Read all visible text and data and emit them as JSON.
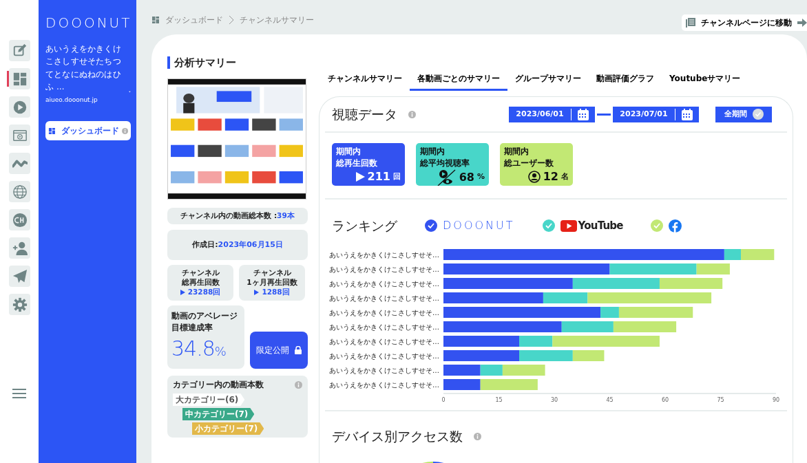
{
  "rail": {
    "items": [
      {
        "kind": "edit",
        "selected": false
      },
      {
        "kind": "dashboard",
        "selected": true
      },
      {
        "kind": "play",
        "selected": false
      },
      {
        "kind": "video",
        "selected": false
      },
      {
        "kind": "wave",
        "selected": false
      },
      {
        "kind": "globe",
        "selected": false
      },
      {
        "kind": "ch",
        "selected": false
      },
      {
        "kind": "add-user",
        "selected": false
      },
      {
        "kind": "send",
        "selected": false
      },
      {
        "kind": "gear",
        "selected": false
      }
    ]
  },
  "brand": {
    "logo": "DOOONUT",
    "channel_name": "あいうえをかきくけこさしすせそたちつてとなにぬねのはひふ …",
    "domain": "aiueo.dooonut.jp",
    "nav_button": "ダッシュボード"
  },
  "breadcrumb": [
    "ダッシュボード",
    "チャンネルサマリー"
  ],
  "channel_page_button": "チャンネルページに移動",
  "summary": {
    "title": "分析サマリー",
    "video_count": {
      "label": "チャンネル内の動画総本数 : ",
      "value": "39本"
    },
    "created": {
      "label": "作成日: ",
      "value": "2023年06月15日"
    },
    "plays": [
      {
        "label": [
          "チャンネル",
          "総再生回数"
        ],
        "value": "23288回"
      },
      {
        "label": [
          "チャンネル",
          "1ヶ月再生回数"
        ],
        "value": "1288回"
      }
    ],
    "achievement": {
      "label": [
        "動画のアベレージ",
        "目標達成率"
      ],
      "value": "34.8",
      "unit": "%"
    },
    "visibility_button": "限定公開",
    "categories": {
      "title": "カテゴリー内の動画本数",
      "steps": [
        {
          "label": "大カテゴリー(6)",
          "color": "#ffffff"
        },
        {
          "label": "中カテゴリー(7)",
          "color": "#3aa98a"
        },
        {
          "label": "小カテゴリー(7)",
          "color": "#e2b84a"
        }
      ]
    }
  },
  "tabs": [
    {
      "label": "チャンネルサマリー",
      "selected": false
    },
    {
      "label": "各動画ごとのサマリー",
      "selected": true
    },
    {
      "label": "グループサマリー",
      "selected": false
    },
    {
      "label": "動画評価グラフ",
      "selected": false
    },
    {
      "label": "Youtubeサマリー",
      "selected": false
    }
  ],
  "viewing": {
    "title": "視聴データ",
    "date_from": "2023/06/01",
    "date_to": "2023/07/01",
    "all_period_button": "全期間",
    "stats": [
      {
        "kind": "plays",
        "label": [
          "期間内",
          "総再生回数"
        ],
        "value": "211",
        "unit": "回",
        "color": "#3352f0"
      },
      {
        "kind": "watch-rate",
        "label": [
          "期間内",
          "総平均視聴率"
        ],
        "value": "68",
        "unit": "%",
        "color": "#48d6c9"
      },
      {
        "kind": "users",
        "label": [
          "期間内",
          "総ユーザー数"
        ],
        "value": "12",
        "unit": "名",
        "color": "#c2e874"
      }
    ]
  },
  "ranking": {
    "title": "ランキング",
    "legend": [
      {
        "kind": "dooonut",
        "color": "#3352f0",
        "checked": true
      },
      {
        "kind": "youtube",
        "color": "#48d6c9",
        "checked": true
      },
      {
        "kind": "facebook",
        "color": "#c2e874",
        "checked": true
      }
    ],
    "chart_data": {
      "type": "bar",
      "orientation": "horizontal",
      "stacked": true,
      "categories": [
        "あいうえをかきくけこさしすせそ…",
        "あいうえをかきくけこさしすせそ…",
        "あいうえをかきくけこさしすせそ…",
        "あいうえをかきくけこさしすせそ…",
        "あいうえをかきくけこさしすせそ…",
        "あいうえをかきくけこさしすせそ…",
        "あいうえをかきくけこさしすせそ…",
        "あいうえをかきくけこさしすせそ…",
        "あいうえをかきくけこさしすせそ…",
        "あいうえをかきくけこさしすせそ…"
      ],
      "series": [
        {
          "name": "DOOONUT",
          "color": "#3352f0",
          "values": [
            76,
            45,
            35,
            27,
            42.5,
            32,
            20.5,
            20.5,
            10,
            10
          ]
        },
        {
          "name": "YouTube",
          "color": "#48d6c9",
          "values": [
            4.5,
            23.5,
            23.5,
            12,
            5,
            14,
            9,
            14.5,
            6,
            0
          ]
        },
        {
          "color": "#c2e874",
          "values": [
            9,
            9,
            17,
            33.5,
            20,
            17,
            29,
            8.5,
            11.5,
            15.5
          ]
        }
      ],
      "xlim": [
        0,
        90
      ],
      "xticks": [
        0,
        15,
        30,
        45,
        60,
        75,
        90
      ]
    }
  },
  "devices": {
    "title": "デバイス別アクセス数"
  }
}
